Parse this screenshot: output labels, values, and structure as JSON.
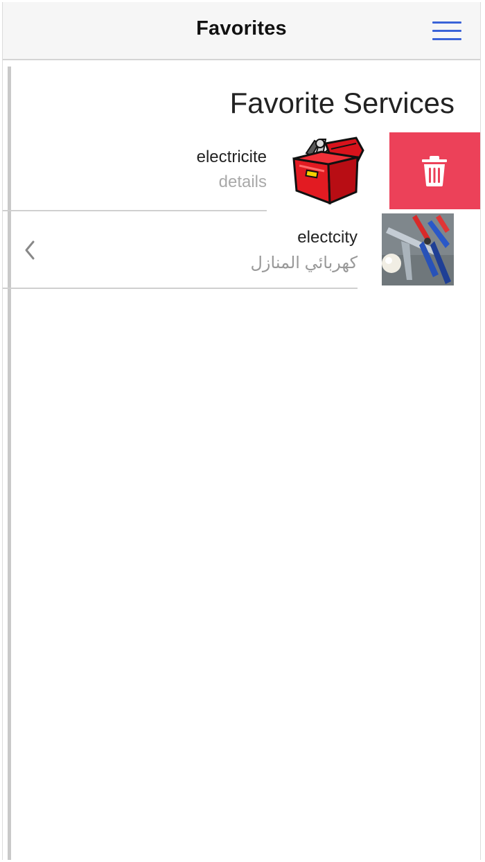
{
  "header": {
    "title": "Favorites",
    "menu_icon": "hamburger-menu-icon",
    "menu_color": "#3a63d8"
  },
  "main": {
    "section_title": "Favorite Services",
    "items": [
      {
        "name": "electricite",
        "detail": "details",
        "thumbnail": "toolbox-image",
        "swiped_open": true,
        "action": {
          "icon": "trash-icon",
          "color": "#ec4159"
        }
      },
      {
        "name": "electcity",
        "detail": "كهربائي المنازل",
        "thumbnail": "electrician-tools-photo",
        "trailing_icon": "chevron-left-icon"
      }
    ]
  }
}
